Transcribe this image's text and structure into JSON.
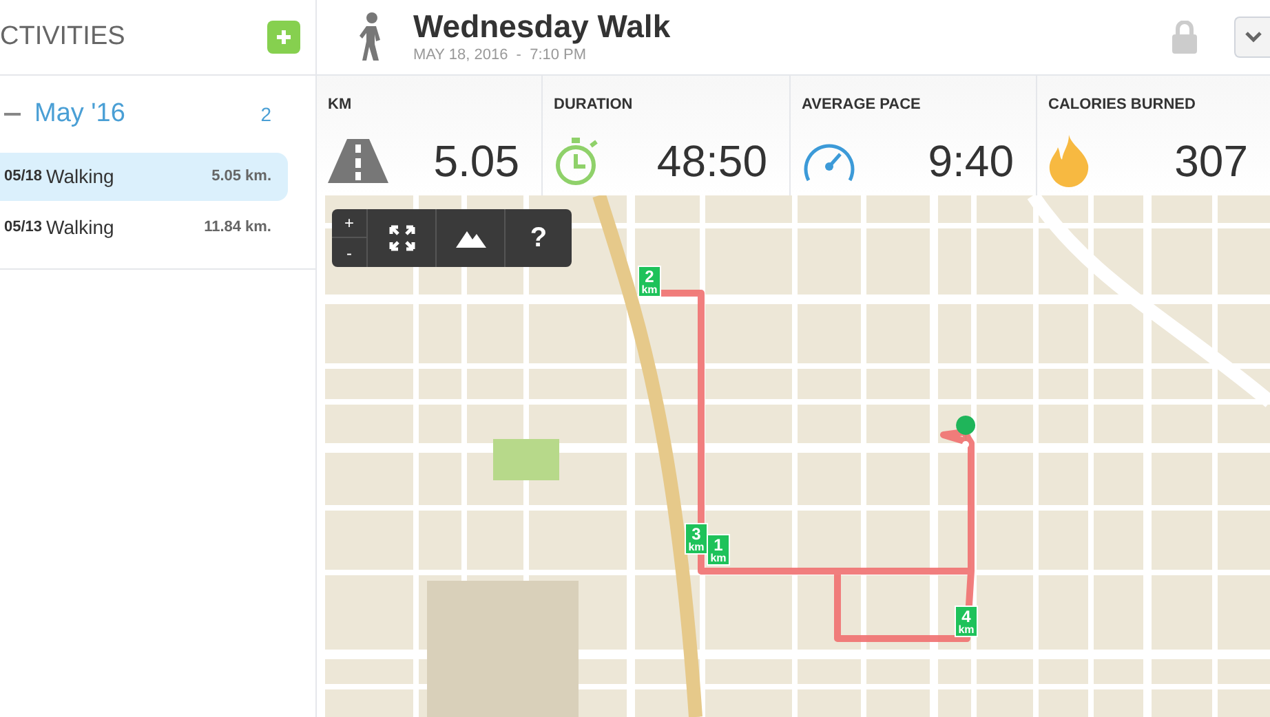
{
  "sidebar": {
    "title": "CTIVITIES",
    "groups": [
      {
        "label": "May '16",
        "count": "2",
        "expanded": true,
        "items": [
          {
            "date": "05/18",
            "name": "Walking",
            "distance": "5.05 km.",
            "selected": true
          },
          {
            "date": "05/13",
            "name": "Walking",
            "distance": "11.84 km.",
            "selected": false
          }
        ]
      }
    ]
  },
  "activity": {
    "title": "Wednesday Walk",
    "datetime": "MAY 18, 2016  -  7:10 PM"
  },
  "stats": [
    {
      "kind": "distance",
      "label": "KM",
      "value": "5.05"
    },
    {
      "kind": "duration",
      "label": "DURATION",
      "value": "48:50"
    },
    {
      "kind": "pace",
      "label": "AVERAGE PACE",
      "value": "9:40"
    },
    {
      "kind": "calories",
      "label": "CALORIES BURNED",
      "value": "307"
    }
  ],
  "map": {
    "zoom_in": "+",
    "zoom_out": "-",
    "help": "?",
    "markers": [
      {
        "number": "2",
        "unit": "km"
      },
      {
        "number": "3",
        "unit": "km"
      },
      {
        "number": "1",
        "unit": "km"
      },
      {
        "number": "4",
        "unit": "km"
      }
    ]
  }
}
